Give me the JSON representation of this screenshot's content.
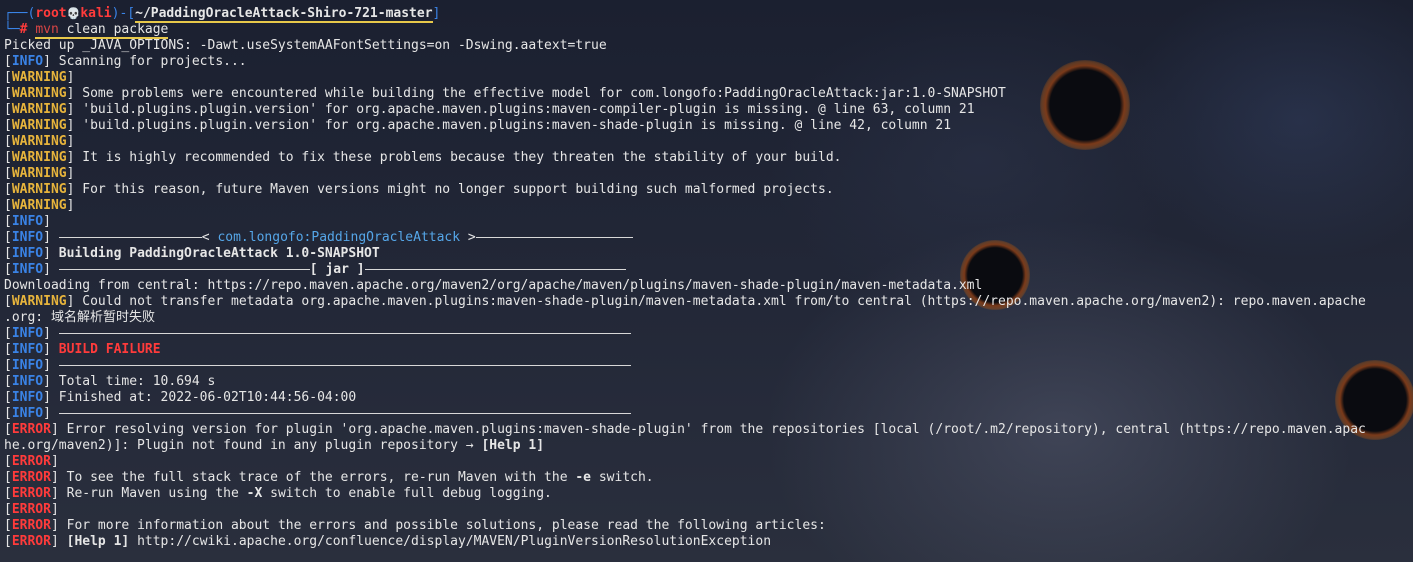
{
  "prompt": {
    "corner_top": "┌──(",
    "user": "root",
    "skull": "💀",
    "host": "kali",
    "mid": ")-[",
    "cwd": "~/PaddingOracleAttack-Shiro-721-master",
    "close": "]",
    "corner_bottom": "└─",
    "hash": "#",
    "cmd_bin": "mvn",
    "cmd_args": " clean package"
  },
  "output": [
    {
      "tag": "",
      "text": "Picked up _JAVA_OPTIONS: -Dawt.useSystemAAFontSettings=on -Dswing.aatext=true"
    },
    {
      "tag": "INFO",
      "text": " Scanning for projects..."
    },
    {
      "tag": "WARNING",
      "text": ""
    },
    {
      "tag": "WARNING",
      "text": " Some problems were encountered while building the effective model for com.longofo:PaddingOracleAttack:jar:1.0-SNAPSHOT"
    },
    {
      "tag": "WARNING",
      "text": " 'build.plugins.plugin.version' for org.apache.maven.plugins:maven-compiler-plugin is missing. @ line 63, column 21"
    },
    {
      "tag": "WARNING",
      "text": " 'build.plugins.plugin.version' for org.apache.maven.plugins:maven-shade-plugin is missing. @ line 42, column 21"
    },
    {
      "tag": "WARNING",
      "text": ""
    },
    {
      "tag": "WARNING",
      "text": " It is highly recommended to fix these problems because they threaten the stability of your build."
    },
    {
      "tag": "WARNING",
      "text": ""
    },
    {
      "tag": "WARNING",
      "text": " For this reason, future Maven versions might no longer support building such malformed projects."
    },
    {
      "tag": "WARNING",
      "text": ""
    },
    {
      "tag": "INFO",
      "text": ""
    }
  ],
  "banner": {
    "artifact": "com.longofo:PaddingOracleAttack",
    "building": "Building PaddingOracleAttack 1.0-SNAPSHOT",
    "packaging": "[ jar ]"
  },
  "download": {
    "text": "Downloading from central: https://repo.maven.apache.org/maven2/org/apache/maven/plugins/maven-shade-plugin/maven-metadata.xml",
    "warn_text": " Could not transfer metadata org.apache.maven.plugins:maven-shade-plugin/maven-metadata.xml from/to central (https://repo.maven.apache.org/maven2): repo.maven.apache",
    "warn_cont": ".org: 域名解析暂时失败"
  },
  "result": {
    "status": "BUILD FAILURE",
    "total_time": " Total time: 10.694 s",
    "finished": " Finished at: 2022-06-02T10:44:56-04:00"
  },
  "errors": {
    "first": " Error resolving version for plugin 'org.apache.maven.plugins:maven-shade-plugin' from the repositories [local (/root/.m2/repository), central (https://repo.maven.apac",
    "first_cont": "he.org/maven2)]: Plugin not found in any plugin repository ",
    "arrow": "→",
    "help": "[Help 1]",
    "trace_pre": " To see the full stack trace of the errors, re-run Maven with the ",
    "trace_flag": "-e",
    "trace_post": " switch.",
    "debug_pre": " Re-run Maven using the ",
    "debug_flag": "-X",
    "debug_post": " switch to enable full debug logging.",
    "more": " For more information about the errors and possible solutions, please read the following articles:",
    "link_label": "[Help 1]",
    "link": " http://cwiki.apache.org/confluence/display/MAVEN/PluginVersionResolutionException"
  },
  "tags": {
    "info": "INFO",
    "warning": "WARNING",
    "error": "ERROR"
  }
}
